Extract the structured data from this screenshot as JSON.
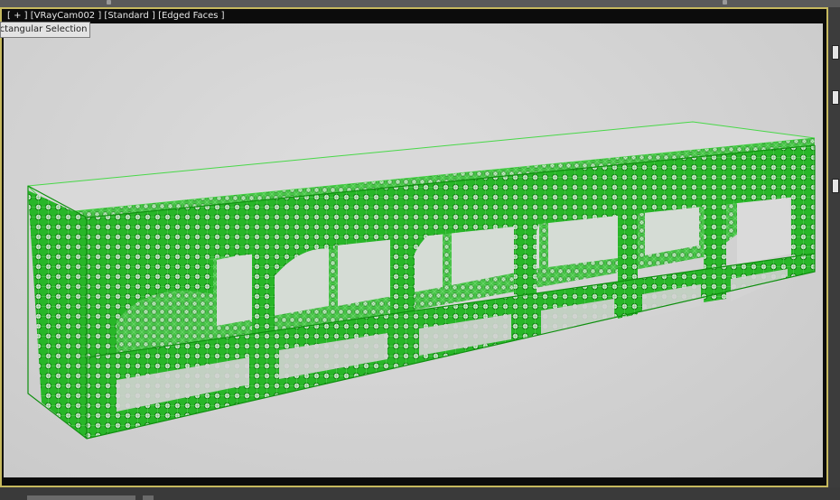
{
  "viewport": {
    "label": "[ + ] [VRayCam002 ] [Standard ] [Edged Faces ]",
    "tooltip": "Rectangular Selection Region"
  },
  "colors": {
    "accent_border": "#c6b95e",
    "wire": "#1fb51f",
    "wire_light": "#3ed23e",
    "background": "#d4d4d4"
  }
}
